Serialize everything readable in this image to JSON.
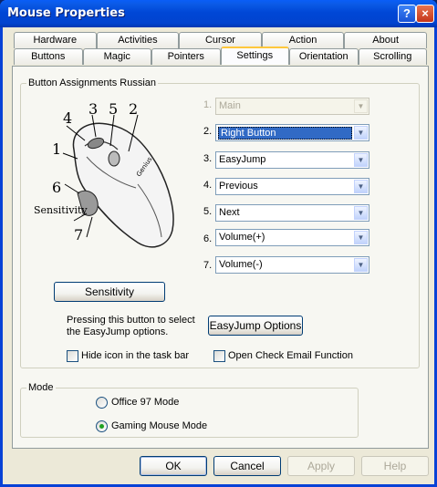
{
  "window": {
    "title": "Mouse Properties",
    "help": "?",
    "close": "×"
  },
  "tabs_row1": [
    "Hardware",
    "Activities",
    "Cursor",
    "Action",
    "About"
  ],
  "tabs_row2": [
    "Buttons",
    "Magic",
    "Pointers",
    "Settings",
    "Orientation",
    "Scrolling"
  ],
  "active_tab": "Settings",
  "button_group": {
    "title": "Button  Assignments Russian",
    "diagram_labels": [
      "4",
      "3",
      "5",
      "2",
      "1",
      "6",
      "Sensitivity",
      "7"
    ],
    "brand": "Genius",
    "assignments": [
      {
        "num": "1.",
        "value": "Main",
        "disabled": true
      },
      {
        "num": "2.",
        "value": "Right Button",
        "selected": true
      },
      {
        "num": "3.",
        "value": "EasyJump"
      },
      {
        "num": "4.",
        "value": "Previous"
      },
      {
        "num": "5.",
        "value": "Next"
      },
      {
        "num": "6.",
        "value": "Volume(+)"
      },
      {
        "num": "7.",
        "value": "Volume(-)"
      }
    ],
    "sensitivity_button": "Sensitivity",
    "easyjump_hint": "Pressing this button to select the EasyJump options.",
    "easyjump_button": "EasyJump Options",
    "hide_icon_label": "Hide icon in the task bar",
    "check_email_label": "Open Check Email Function"
  },
  "mode_group": {
    "title": "Mode",
    "options": [
      {
        "label": "Office 97 Mode",
        "checked": false
      },
      {
        "label": "Gaming Mouse Mode",
        "checked": true
      }
    ]
  },
  "footer": {
    "ok": "OK",
    "cancel": "Cancel",
    "apply": "Apply",
    "help": "Help"
  }
}
